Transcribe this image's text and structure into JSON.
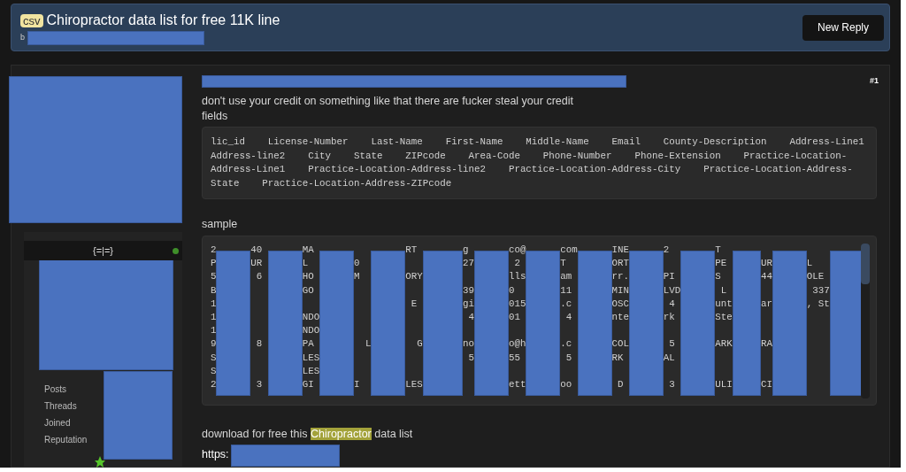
{
  "thread": {
    "prefix": "csv",
    "title": "Chiropractor data list for free 11K line",
    "by": "b"
  },
  "new_reply": "New Reply",
  "user": {
    "title": "{=|=}",
    "online": true,
    "stats": [
      "Posts",
      "Threads",
      "Joined",
      "Reputation"
    ]
  },
  "post": {
    "number": "#1",
    "text": "don't use your credit on something like that there are fucker steal your credit",
    "fields_label": "fields",
    "fields": "lic_id    License-Number    Last-Name    First-Name    Middle-Name    Email    County-Description    Address-Line1    Address-line2    City    State    ZIPcode    Area-Code    Phone-Number    Phone-Extension    Practice-Location-Address-Line1    Practice-Location-Address-line2    Practice-Location-Address-City    Practice-Location-Address-State    Practice-Location-Address-ZIPcode",
    "sample_label": "sample",
    "sample_lines": [
      "2      40       MA                RT        g       co@      com      INE      2        T",
      "P      UR       L        0                  27       2       T        ORT               PE      UR      L",
      "5       6       HO       M        ORY               lls      am       rr.      PI       S       44      OLE",
      "B               GO                          39      0        11       MIN      LVD       L               337",
      "1                                  E        gi      015      .c       OSC       4       unt     ar      , St",
      "1               NDO                          4      01        4       nte      rk       Ste",
      "1               NDO",
      "9       8       PA         L        G       no      o@h      .c       COL       5       ARK     RA",
      "S               LES                          5      55        5       RK       AL",
      "S               LES",
      "2       3       GI       I        LES               ett      oo        D        3       ULI     CI"
    ],
    "download": {
      "before": "download for free this ",
      "highlight": "Chiropractor",
      "after": " data list"
    },
    "link": "https:"
  }
}
